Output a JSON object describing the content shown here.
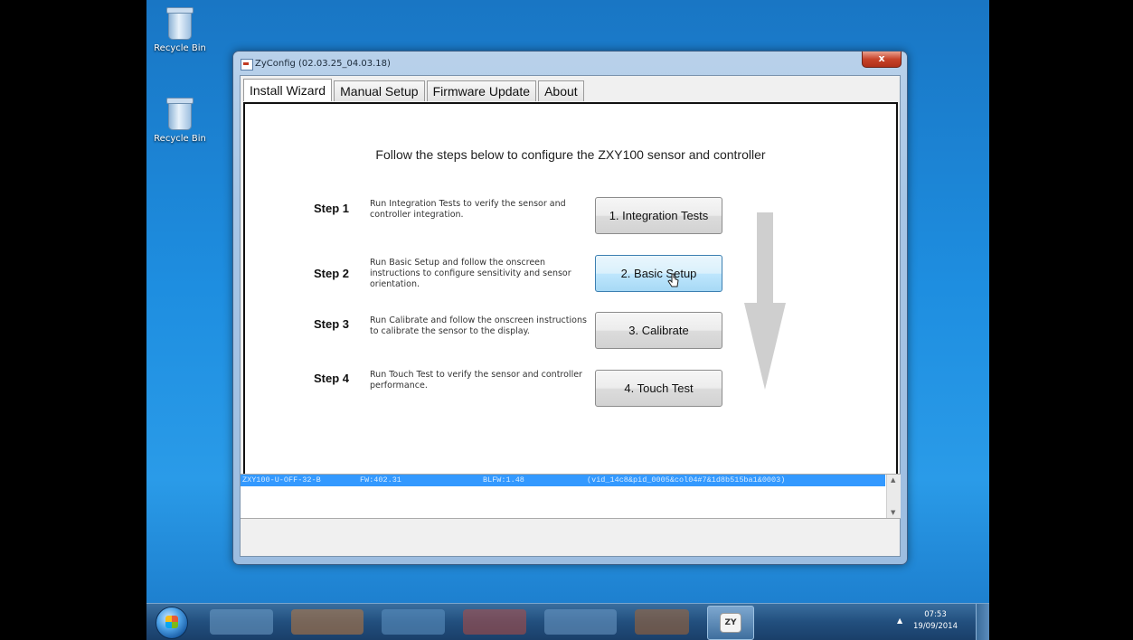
{
  "desktop": {
    "icons": [
      {
        "label": "Recycle Bin",
        "icon": "recycle-bin-full-icon"
      },
      {
        "label": "Recycle Bin",
        "icon": "recycle-bin-empty-icon"
      }
    ]
  },
  "window": {
    "title": "ZyConfig (02.03.25_04.03.18)",
    "close_label": "x",
    "tabs": [
      {
        "label": "Install Wizard",
        "active": true
      },
      {
        "label": "Manual Setup",
        "active": false
      },
      {
        "label": "Firmware Update",
        "active": false
      },
      {
        "label": "About",
        "active": false
      }
    ]
  },
  "wizard": {
    "headline": "Follow the steps below to configure the ZXY100 sensor and controller",
    "steps": [
      {
        "label": "Step 1",
        "description": "Run Integration Tests to verify the sensor and controller integration.",
        "button": "1. Integration Tests"
      },
      {
        "label": "Step 2",
        "description": "Run Basic Setup and follow the onscreen instructions to configure sensitivity and sensor orientation.",
        "button": "2. Basic Setup"
      },
      {
        "label": "Step 3",
        "description": "Run Calibrate and follow the onscreen instructions to calibrate the sensor to the display.",
        "button": "3. Calibrate"
      },
      {
        "label": "Step 4",
        "description": "Run Touch Test to verify the sensor and controller performance.",
        "button": "4. Touch Test"
      }
    ],
    "arrow_icon": "down-arrow-icon",
    "hovered_button": "2. Basic Setup"
  },
  "device_list": {
    "rows": [
      {
        "model": "ZXY100-U-OFF-32-B",
        "fw": "FW:402.31",
        "blfw": "BLFW:1.48",
        "id": "(vid_14c8&pid_0005&col04#7&1d8b515ba1&0003)"
      }
    ]
  },
  "taskbar": {
    "start_icon": "windows-start-orb-icon",
    "pinned_app_label": "ZY",
    "tray_arrow": "▲",
    "time": "07:53",
    "date": "19/09/2014"
  }
}
